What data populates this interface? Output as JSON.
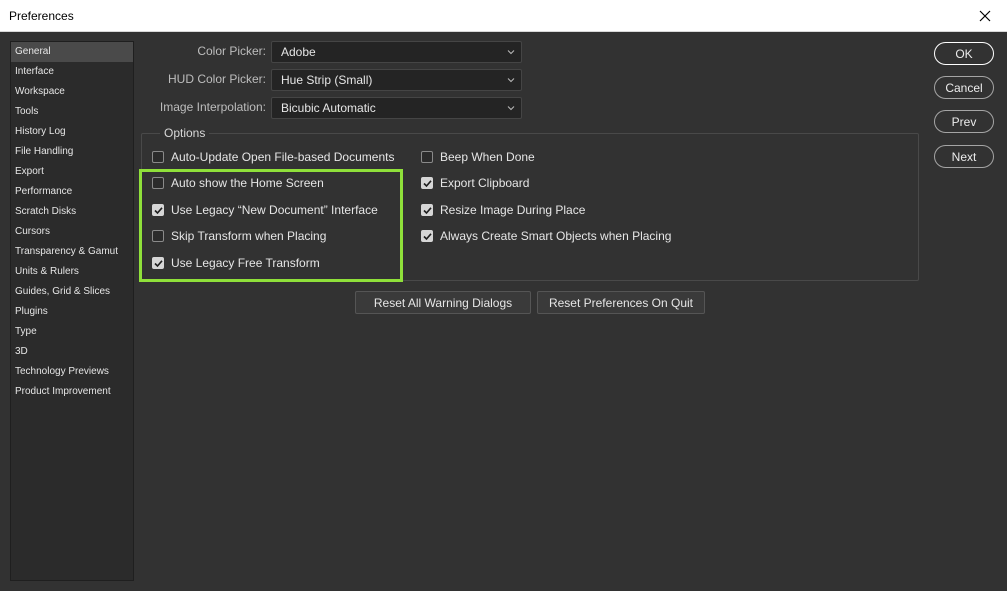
{
  "window": {
    "title": "Preferences"
  },
  "sidebar": {
    "items": [
      "General",
      "Interface",
      "Workspace",
      "Tools",
      "History Log",
      "File Handling",
      "Export",
      "Performance",
      "Scratch Disks",
      "Cursors",
      "Transparency & Gamut",
      "Units & Rulers",
      "Guides, Grid & Slices",
      "Plugins",
      "Type",
      "3D",
      "Technology Previews",
      "Product Improvement"
    ],
    "selected": "General"
  },
  "fields": {
    "color_picker": {
      "label": "Color Picker:",
      "value": "Adobe"
    },
    "hud_color_picker": {
      "label": "HUD Color Picker:",
      "value": "Hue Strip (Small)"
    },
    "image_interpolation": {
      "label": "Image Interpolation:",
      "value": "Bicubic Automatic"
    }
  },
  "options": {
    "title": "Options",
    "left": [
      {
        "label": "Auto-Update Open File-based Documents",
        "checked": false
      },
      {
        "label": "Auto show the Home Screen",
        "checked": false
      },
      {
        "label": "Use Legacy “New Document” Interface",
        "checked": true
      },
      {
        "label": "Skip Transform when Placing",
        "checked": false
      },
      {
        "label": "Use Legacy Free Transform",
        "checked": true
      }
    ],
    "right": [
      {
        "label": "Beep When Done",
        "checked": false
      },
      {
        "label": "Export Clipboard",
        "checked": true
      },
      {
        "label": "Resize Image During Place",
        "checked": true
      },
      {
        "label": "Always Create Smart Objects when Placing",
        "checked": true
      }
    ]
  },
  "buttons": {
    "reset_warnings": "Reset All Warning Dialogs",
    "reset_prefs": "Reset Preferences On Quit",
    "ok": "OK",
    "cancel": "Cancel",
    "prev": "Prev",
    "next": "Next"
  },
  "colors": {
    "highlight": "#8fe03a",
    "background": "#323232"
  }
}
